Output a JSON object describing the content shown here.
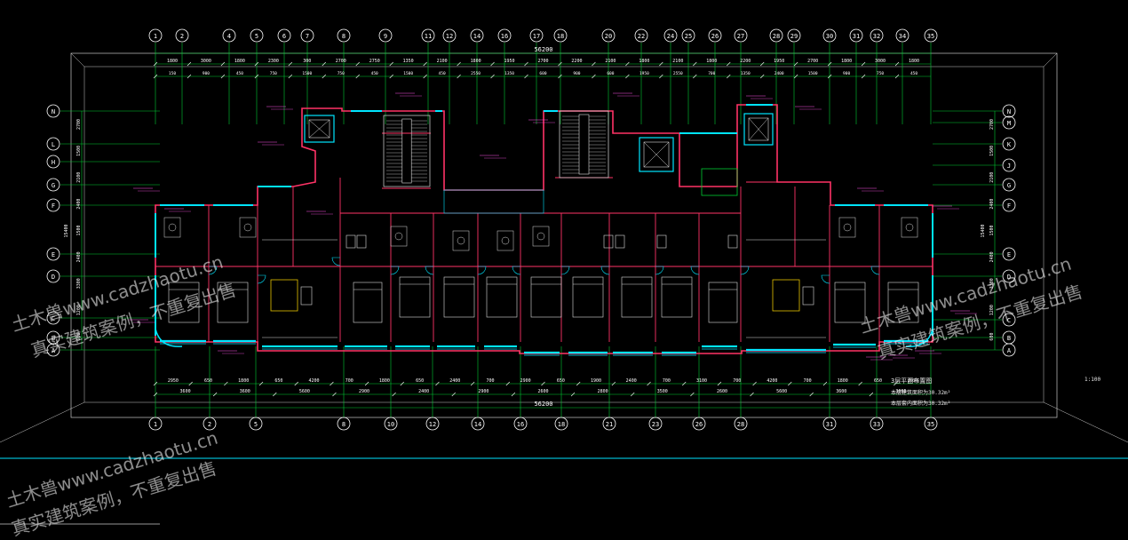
{
  "columns_top": [
    "1",
    "2",
    "4",
    "5",
    "6",
    "7",
    "8",
    "9",
    "11",
    "12",
    "14",
    "16",
    "17",
    "18",
    "20",
    "22",
    "24",
    "25",
    "26",
    "27",
    "28",
    "29",
    "30",
    "31",
    "32",
    "34",
    "35"
  ],
  "columns_bottom": [
    "1",
    "2",
    "5",
    "8",
    "10",
    "12",
    "14",
    "16",
    "18",
    "21",
    "23",
    "26",
    "28",
    "31",
    "33",
    "35"
  ],
  "rows_left": [
    "N",
    "L",
    "H",
    "G",
    "F",
    "E",
    "D",
    "C",
    "B",
    "A"
  ],
  "rows_right": [
    "N",
    "M",
    "K",
    "J",
    "G",
    "F",
    "E",
    "D",
    "C",
    "B",
    "A"
  ],
  "total_dimension_top": "56200",
  "total_dimension_bottom": "56200",
  "dim_top_row1": [
    "1800",
    "3000",
    "1800",
    "2300",
    "300",
    "2700",
    "2750",
    "1350",
    "2100",
    "1800",
    "1950",
    "2700",
    "2200",
    "2100",
    "1800",
    "2100",
    "1800",
    "2200",
    "1950",
    "2700",
    "1800",
    "3000",
    "1800"
  ],
  "dim_top_row2": [
    "150",
    "900",
    "450",
    "750",
    "1500",
    "750",
    "450",
    "1500",
    "450",
    "2550",
    "1350",
    "600",
    "900",
    "600",
    "1950",
    "2550",
    "700",
    "1350",
    "2400",
    "1500",
    "900",
    "750",
    "450"
  ],
  "dim_bottom_row1": [
    "2950",
    "650",
    "1800",
    "650",
    "4200",
    "700",
    "1800",
    "650",
    "2400",
    "700",
    "2900",
    "650",
    "1900",
    "2400",
    "700",
    "3100",
    "700",
    "4200",
    "700",
    "1800",
    "650",
    "2950"
  ],
  "dim_bottom_row2": [
    "3600",
    "3600",
    "5600",
    "2900",
    "2400",
    "2900",
    "2600",
    "2800",
    "3500",
    "2600",
    "5600",
    "3600",
    "3600"
  ],
  "side_dims_left": [
    "2700",
    "1500",
    "2100",
    "2400",
    "1500",
    "2400",
    "3300",
    "1200",
    "600"
  ],
  "side_dims_right": [
    "2700",
    "1500",
    "2100",
    "2400",
    "1500",
    "2400",
    "3300",
    "1200",
    "600"
  ],
  "side_total": "15400",
  "drawing_title": "3层平面布置图",
  "scale_note": "1:100",
  "area_line_1": "本层建筑面积为30.32m²",
  "area_line_2": "本层套内面积为30.32m²",
  "watermark_lines": [
    "土木兽www.cadzhaotu.cn",
    "真实建筑案例，不重复出售"
  ],
  "colors": {
    "background": "#000000",
    "grid_axis": "#00cc33",
    "wall": "#ff3366",
    "window": "#00e5ff",
    "furniture": "#dcdcdc",
    "dimension": "#ffffff",
    "annotation": "#ff4fe8",
    "border": "#c8c8c8"
  }
}
